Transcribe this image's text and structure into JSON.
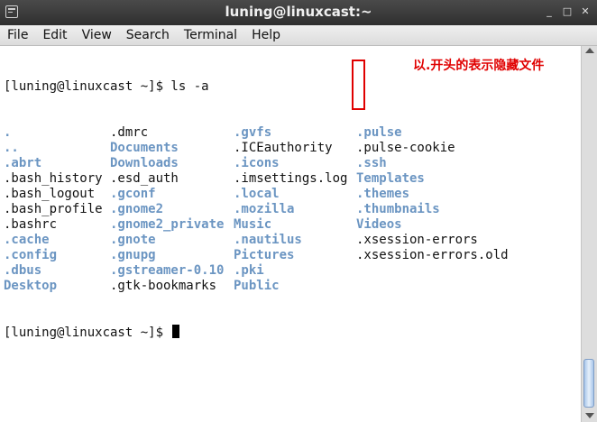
{
  "window": {
    "title": "luning@linuxcast:~",
    "buttons": {
      "minimize": "_",
      "maximize": "□",
      "close": "✕"
    },
    "icon": "terminal-icon"
  },
  "menu": [
    "File",
    "Edit",
    "View",
    "Search",
    "Terminal",
    "Help"
  ],
  "terminal": {
    "prompt": "[luning@linuxcast ~]$ ls -a",
    "rows": [
      [
        {
          "t": ".",
          "dir": true
        },
        {
          "t": ".dmrc",
          "dir": false
        },
        {
          "t": ".gvfs",
          "dir": true
        },
        {
          "t": ".pulse",
          "dir": true
        }
      ],
      [
        {
          "t": "..",
          "dir": true
        },
        {
          "t": "Documents",
          "dir": true
        },
        {
          "t": ".ICEauthority",
          "dir": false
        },
        {
          "t": ".pulse-cookie",
          "dir": false
        }
      ],
      [
        {
          "t": ".abrt",
          "dir": true
        },
        {
          "t": "Downloads",
          "dir": true
        },
        {
          "t": ".icons",
          "dir": true
        },
        {
          "t": ".ssh",
          "dir": true
        }
      ],
      [
        {
          "t": ".bash_history",
          "dir": false
        },
        {
          "t": ".esd_auth",
          "dir": false
        },
        {
          "t": ".imsettings.log",
          "dir": false
        },
        {
          "t": "Templates",
          "dir": true
        }
      ],
      [
        {
          "t": ".bash_logout",
          "dir": false
        },
        {
          "t": ".gconf",
          "dir": true
        },
        {
          "t": ".local",
          "dir": true
        },
        {
          "t": ".themes",
          "dir": true
        }
      ],
      [
        {
          "t": ".bash_profile",
          "dir": false
        },
        {
          "t": ".gnome2",
          "dir": true
        },
        {
          "t": ".mozilla",
          "dir": true
        },
        {
          "t": ".thumbnails",
          "dir": true
        }
      ],
      [
        {
          "t": ".bashrc",
          "dir": false
        },
        {
          "t": ".gnome2_private",
          "dir": true
        },
        {
          "t": "Music",
          "dir": true
        },
        {
          "t": "Videos",
          "dir": true
        }
      ],
      [
        {
          "t": ".cache",
          "dir": true
        },
        {
          "t": ".gnote",
          "dir": true
        },
        {
          "t": ".nautilus",
          "dir": true
        },
        {
          "t": ".xsession-errors",
          "dir": false
        }
      ],
      [
        {
          "t": ".config",
          "dir": true
        },
        {
          "t": ".gnupg",
          "dir": true
        },
        {
          "t": "Pictures",
          "dir": true
        },
        {
          "t": ".xsession-errors.old",
          "dir": false
        }
      ],
      [
        {
          "t": ".dbus",
          "dir": true
        },
        {
          "t": ".gstreamer-0.10",
          "dir": true
        },
        {
          "t": ".pki",
          "dir": true
        },
        {
          "t": "",
          "dir": false
        }
      ],
      [
        {
          "t": "Desktop",
          "dir": true
        },
        {
          "t": ".gtk-bookmarks",
          "dir": false
        },
        {
          "t": "Public",
          "dir": true
        },
        {
          "t": "",
          "dir": false
        }
      ]
    ],
    "final_prompt": "[luning@linuxcast ~]$ "
  },
  "annotation": {
    "text": "以.开头的表示隐藏文件",
    "color": "#e00000"
  },
  "colors": {
    "directory": "#6b95c2",
    "titlebar": "#3a3a3a",
    "scroll_thumb": "#a8c6ea"
  }
}
